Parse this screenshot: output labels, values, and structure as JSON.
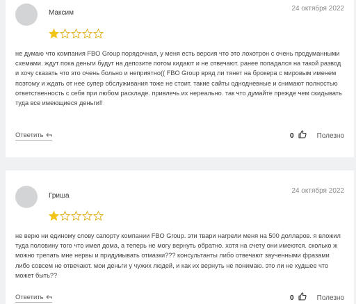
{
  "reviews": [
    {
      "author": "Максим",
      "date": "24 октября 2022",
      "rating": 1,
      "text": "не думаю что компания FBO Group порядочная, у меня есть версия что это лохотрон с очень продуманными схемами. ждут пока деньги будут на депозите потом кидают и не отвечают. ранее попадался на такой развод и хочу сказать что это очень больно и неприятно(( FBO Group вряд ли тянет на брокера с мировым именем поэтому и ждать от нее супер обслуживания тоже не стоит. такие сайты однодневные и снимают полностью ответственность с себя при любом раскладе. привлечь их нереально. так что думайте прежде чем скидывать туда все имеющиеся деньги!!",
      "reply_label": "Ответить",
      "likes": "0",
      "useful_label": "Полезно"
    },
    {
      "author": "Гриша",
      "date": "24 октября 2022",
      "rating": 1,
      "text": "не верю ни единому слову сапорту компании FBO Group. эти твари нагрели меня на 500 долларов. я вложил туда половину того что имел дома, а теперь не могу вернуть обратно. хотя на счету они имеются. сколько ж можно трепать мне нервы и придумывать отмазки??? консультанты либо отвечают заученными фразами либо совсем не отвечают. мои деньги у чужих людей, и как их вернуть не понимаю. это ли не худшее что может быть??",
      "reply_label": "Ответить",
      "likes": "0",
      "useful_label": "Полезно"
    }
  ],
  "colors": {
    "star_filled": "#f0c419",
    "star_outline": "#e0b020",
    "background": "#f0f1f3",
    "card": "#ffffff"
  },
  "icons": {
    "star": "star-icon",
    "reply": "reply-arrow-icon",
    "like": "thumbs-up-icon"
  }
}
